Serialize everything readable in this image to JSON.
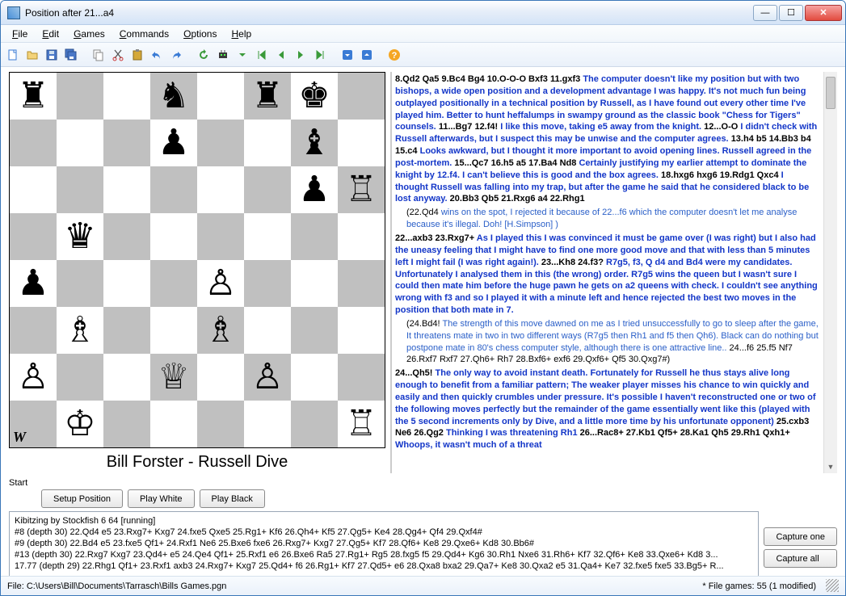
{
  "window": {
    "title": "Position after 21...a4"
  },
  "menu": {
    "file": "File",
    "edit": "Edit",
    "games": "Games",
    "commands": "Commands",
    "options": "Options",
    "help": "Help"
  },
  "board": {
    "layout": [
      [
        "♜",
        "",
        "",
        "♞",
        "",
        "♜",
        "♚",
        ""
      ],
      [
        "",
        "",
        "",
        "♟",
        "",
        "",
        "♝",
        ""
      ],
      [
        "",
        "",
        "",
        "",
        "",
        "",
        "♟",
        "♖"
      ],
      [
        "",
        "♛",
        "",
        "",
        "",
        "",
        "",
        ""
      ],
      [
        "♟",
        "",
        "",
        "",
        "♙",
        "",
        "",
        ""
      ],
      [
        "",
        "♗",
        "",
        "",
        "♗",
        "",
        "",
        ""
      ],
      [
        "♙",
        "",
        "",
        "♕",
        "",
        "♙",
        "",
        ""
      ],
      [
        "",
        "♔",
        "",
        "",
        "",
        "",
        "",
        "♖"
      ]
    ],
    "turn": "W"
  },
  "players": "Bill Forster  -  Russell Dive",
  "notation": {
    "p1_moves": "8.Qd2 Qa5 9.Bc4 Bg4 10.O-O-O Bxf3 11.gxf3 ",
    "p1_comment": "The computer doesn't like my position but with two bishops, a wide open position and a development advantage I was happy. It's not much fun being outplayed positionally in a technical position by Russell, as I have found out every other time I've played him. Better to hunt heffalumps in swampy ground as the classic book \"Chess for Tigers\" counsels.",
    "p2_moves": " 11...Bg7 12.f4! ",
    "p2_comment": "I like this move, taking e5 away from the knight.",
    "p3_moves": " 12...O-O ",
    "p3_comment": "I didn't check with Russell afterwards, but I suspect this may be unwise and the computer agrees.",
    "p4_moves": " 13.h4 b5 14.Bb3 b4 15.c4 ",
    "p4_comment": "Looks awkward, but I thought it more important to avoid opening lines. Russell agreed in the post-mortem.",
    "p5_moves": " 15...Qc7 16.h5 a5 17.Ba4 Nd8 ",
    "p5_comment": "Certainly justifying my earlier attempt to dominate the knight by 12.f4. I can't believe this is good and the box agrees.",
    "p6_moves": " 18.hxg6 hxg6 19.Rdg1 Qxc4 ",
    "p6_comment": "I thought Russell was falling into my trap, but after the game he said that he considered black to be lost anyway.",
    "p7_moves": " 20.Bb3 Qb5 21.Rxg6 a4 22.Rhg1",
    "var1_head": "(22.Qd4 ",
    "var1_comment": "wins on the spot, I rejected it because of 22...f6 which the computer doesn't let me analyse because it's illegal. Doh! [H.Simpson]",
    "var1_tail": " )",
    "p8_moves": "22...axb3 23.Rxg7+ ",
    "p8_comment": "As I played this I was convinced it must be game over (I was right) but I also had the uneasy feeling that I might have to find one more good move and that with less than 5 minutes left I might fail (I was right again!).",
    "p9_moves": " 23...Kh8 24.f3? ",
    "p9_comment": "R7g5, f3, Q d4 and Bd4 were my candidates. Unfortunately I analysed them in this (the wrong) order. R7g5 wins the queen but I wasn't sure I could then mate him before the huge pawn he gets on a2 queens with check. I couldn't see anything wrong with f3 and so I played it with a minute left and hence rejected the best two moves in the position that both mate in 7.",
    "var2_head": "(24.Bd4! ",
    "var2_comment": "The strength of this move dawned on me as I tried unsuccessfully to go to sleep after the game, It threatens mate in two in two different ways (R7g5 then Rh1 and f5 then Qh6). Black can do nothing but postpone mate in 80's chess computer style, although there is one attractive line..",
    "var2_moves": " 24...f6 25.f5 Nf7 26.Rxf7 Rxf7 27.Qh6+ Rh7 28.Bxf6+ exf6 29.Qxf6+ Qf5 30.Qxg7#)",
    "p10_moves": "24...Qh5! ",
    "p10_comment": "The only way to avoid instant death. Fortunately for Russell he thus stays alive long enough to benefit from a familiar pattern; The weaker player misses his chance to win quickly and easily and then quickly crumbles under pressure. It's possible I haven't reconstructed one or two of the following moves perfectly but the remainder of the game essentially went like this (played with the 5 second increments only by Dive, and a little more time by his unfortunate opponent)",
    "p11_moves": "   25.cxb3 Ne6 26.Qg2 ",
    "p11_comment": "Thinking I was threatening Rh1",
    "p12_moves": " 26...Rac8+ 27.Kb1 Qf5+ 28.Ka1 Qh5 29.Rh1 Qxh1+ ",
    "p12_comment": "Whoops, it wasn't much of a threat"
  },
  "controls": {
    "start": "Start",
    "setup": "Setup Position",
    "play_white": "Play White",
    "play_black": "Play Black",
    "capture_one": "Capture one",
    "capture_all": "Capture all"
  },
  "kibitz": {
    "header": "Kibitzing by Stockfish 6 64 [running]",
    "lines": [
      "#8 (depth 30) 22.Qd4 e5 23.Rxg7+ Kxg7 24.fxe5 Qxe5 25.Rg1+ Kf6 26.Qh4+ Kf5 27.Qg5+ Ke4 28.Qg4+ Qf4 29.Qxf4#",
      "#9 (depth 30) 22.Bd4 e5 23.fxe5 Qf1+ 24.Rxf1 Ne6 25.Bxe6 fxe6 26.Rxg7+ Kxg7 27.Qg5+ Kf7 28.Qf6+ Ke8 29.Qxe6+ Kd8 30.Bb6#",
      "#13 (depth 30) 22.Rxg7 Kxg7 23.Qd4+ e5 24.Qe4 Qf1+ 25.Rxf1 e6 26.Bxe6 Ra5 27.Rg1+ Rg5 28.fxg5 f5 29.Qd4+ Kg6 30.Rh1 Nxe6 31.Rh6+ Kf7 32.Qf6+ Ke8 33.Qxe6+ Kd8 3...",
      "17.77 (depth 29) 22.Rhg1 Qf1+ 23.Rxf1 axb3 24.Rxg7+ Kxg7 25.Qd4+ f6 26.Rg1+ Kf7 27.Qd5+ e6 28.Qxa8 bxa2 29.Qa7+ Ke8 30.Qxa2 e5 31.Qa4+ Ke7 32.fxe5 fxe5 33.Bg5+ R..."
    ]
  },
  "status": {
    "left": "File: C:\\Users\\Bill\\Documents\\Tarrasch\\Bills Games.pgn",
    "right": "* File games: 55 (1 modified)"
  }
}
